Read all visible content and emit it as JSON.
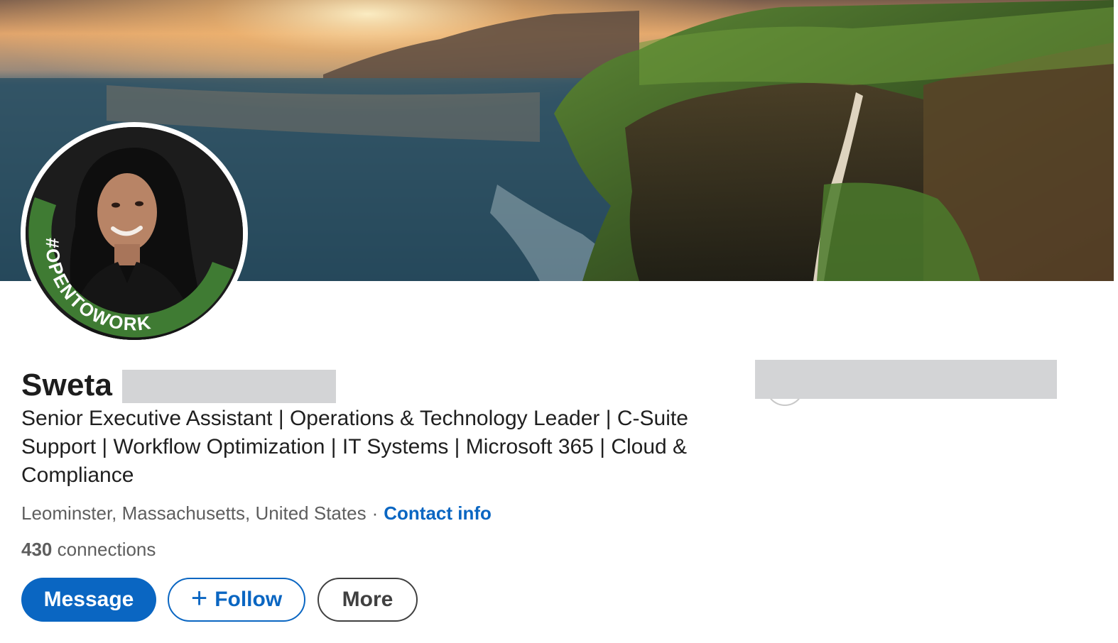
{
  "profile": {
    "first_name": "Sweta",
    "headline": "Senior Executive Assistant | Operations & Technology Leader | C-Suite Support | Workflow Optimization | IT Systems | Microsoft 365 | Cloud & Compliance",
    "location": "Leominster, Massachusetts, United States",
    "separator": "·",
    "contact_info_label": "Contact info",
    "connections_count": "430",
    "connections_label": "connections",
    "open_to_work_badge": "#OPENTOWORK"
  },
  "actions": {
    "message_label": "Message",
    "follow_label": "Follow",
    "follow_icon": "plus-icon",
    "more_label": "More"
  },
  "colors": {
    "primary": "#0a66c2",
    "open_to_work_green": "#3f7b33",
    "redaction": "#d3d4d6"
  }
}
